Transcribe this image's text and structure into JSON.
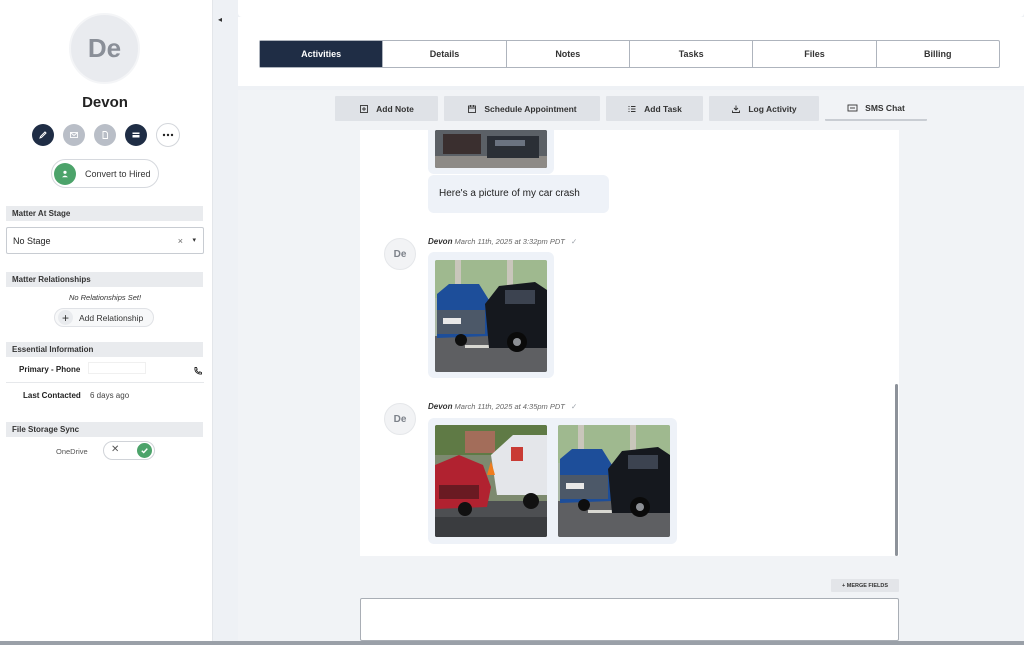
{
  "sidebar": {
    "avatar_initials": "De",
    "contact_name": "Devon",
    "action_icons": [
      "pencil-icon",
      "mail-icon",
      "document-icon",
      "card-icon",
      "more-icon"
    ],
    "convert_label": "Convert to Hired",
    "matter_stage": {
      "header": "Matter At Stage",
      "value": "No Stage",
      "clear": "×",
      "caret": "▾"
    },
    "relationships": {
      "header": "Matter Relationships",
      "empty_text": "No Relationships Set!",
      "add_label": "Add Relationship"
    },
    "essential": {
      "header": "Essential Information",
      "phone_label": "Primary - Phone",
      "last_contacted_label": "Last Contacted",
      "last_contacted_value": "6 days ago"
    },
    "storage": {
      "header": "File Storage Sync",
      "onedrive_label": "OneDrive",
      "toggle_off_glyph": "✕",
      "enabled": true
    },
    "collapse_glyph": "◂"
  },
  "tabs": [
    {
      "label": "Activities",
      "active": true
    },
    {
      "label": "Details",
      "active": false
    },
    {
      "label": "Notes",
      "active": false
    },
    {
      "label": "Tasks",
      "active": false
    },
    {
      "label": "Files",
      "active": false
    },
    {
      "label": "Billing",
      "active": false
    }
  ],
  "subbar": {
    "add_note": "Add Note",
    "schedule": "Schedule Appointment",
    "add_task": "Add Task",
    "log_activity": "Log Activity",
    "sms_chat": "SMS Chat"
  },
  "chat": {
    "msg1_text": "Here's a picture of my car crash",
    "msg2": {
      "avatar": "De",
      "sender": "Devon",
      "timestamp": "March 11th, 2025 at 3:32pm PDT",
      "check": "✓"
    },
    "msg3": {
      "avatar": "De",
      "sender": "Devon",
      "timestamp": "March 11th, 2025 at 4:35pm PDT",
      "check": "✓"
    }
  },
  "compose": {
    "merge_fields_label": "+ MERGE FIELDS",
    "value": ""
  },
  "colors": {
    "navy": "#1f2d45",
    "green": "#4ca36a",
    "bubble": "#eef2f8"
  }
}
